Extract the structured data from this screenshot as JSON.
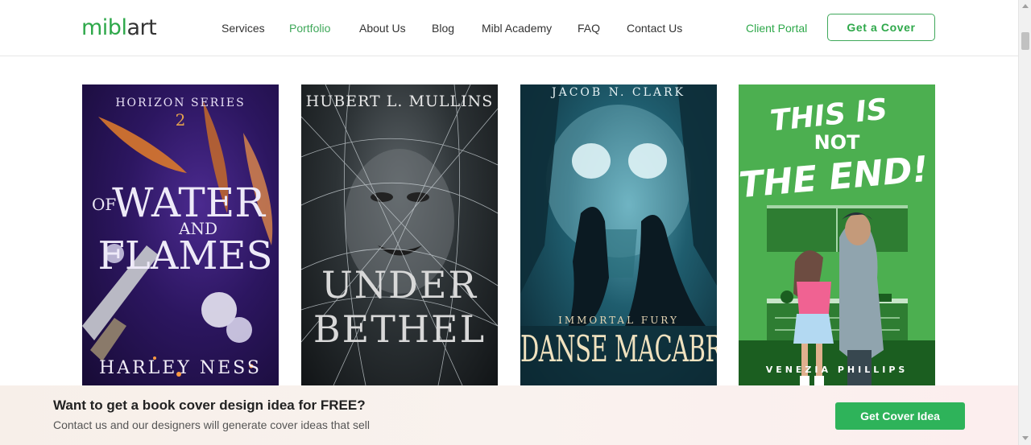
{
  "brand": {
    "logo_mibl": "mibl",
    "logo_art": "art",
    "accent": "#2ea84a"
  },
  "nav": {
    "items": [
      {
        "label": "Services",
        "active": false
      },
      {
        "label": "Portfolio",
        "active": true
      },
      {
        "label": "About Us",
        "active": false
      },
      {
        "label": "Blog",
        "active": false
      },
      {
        "label": "Mibl Academy",
        "active": false
      },
      {
        "label": "FAQ",
        "active": false
      },
      {
        "label": "Contact Us",
        "active": false
      }
    ],
    "client_portal": "Client Portal",
    "get_cover": "Get a Cover"
  },
  "covers": [
    {
      "series": "HORIZON SERIES",
      "number": "2",
      "title_a": "OF",
      "title_b": "WATER",
      "title_c": "AND",
      "title_d": "FLAMES",
      "author": "HARLEY NESS"
    },
    {
      "author": "HUBERT L. MULLINS",
      "title_a": "UNDER",
      "title_b": "BETHEL"
    },
    {
      "author": "JACOB N. CLARK",
      "series": "IMMORTAL FURY",
      "title_a": "DANSE MACABRE"
    },
    {
      "title_a": "THIS IS",
      "title_b": "NOT",
      "title_c": "THE END!",
      "author": "VENEZIA PHILLIPS"
    }
  ],
  "banner": {
    "title": "Want to get a book cover design idea for FREE?",
    "subtitle": "Contact us and our designers will generate cover ideas that sell",
    "button": "Get Cover Idea"
  }
}
